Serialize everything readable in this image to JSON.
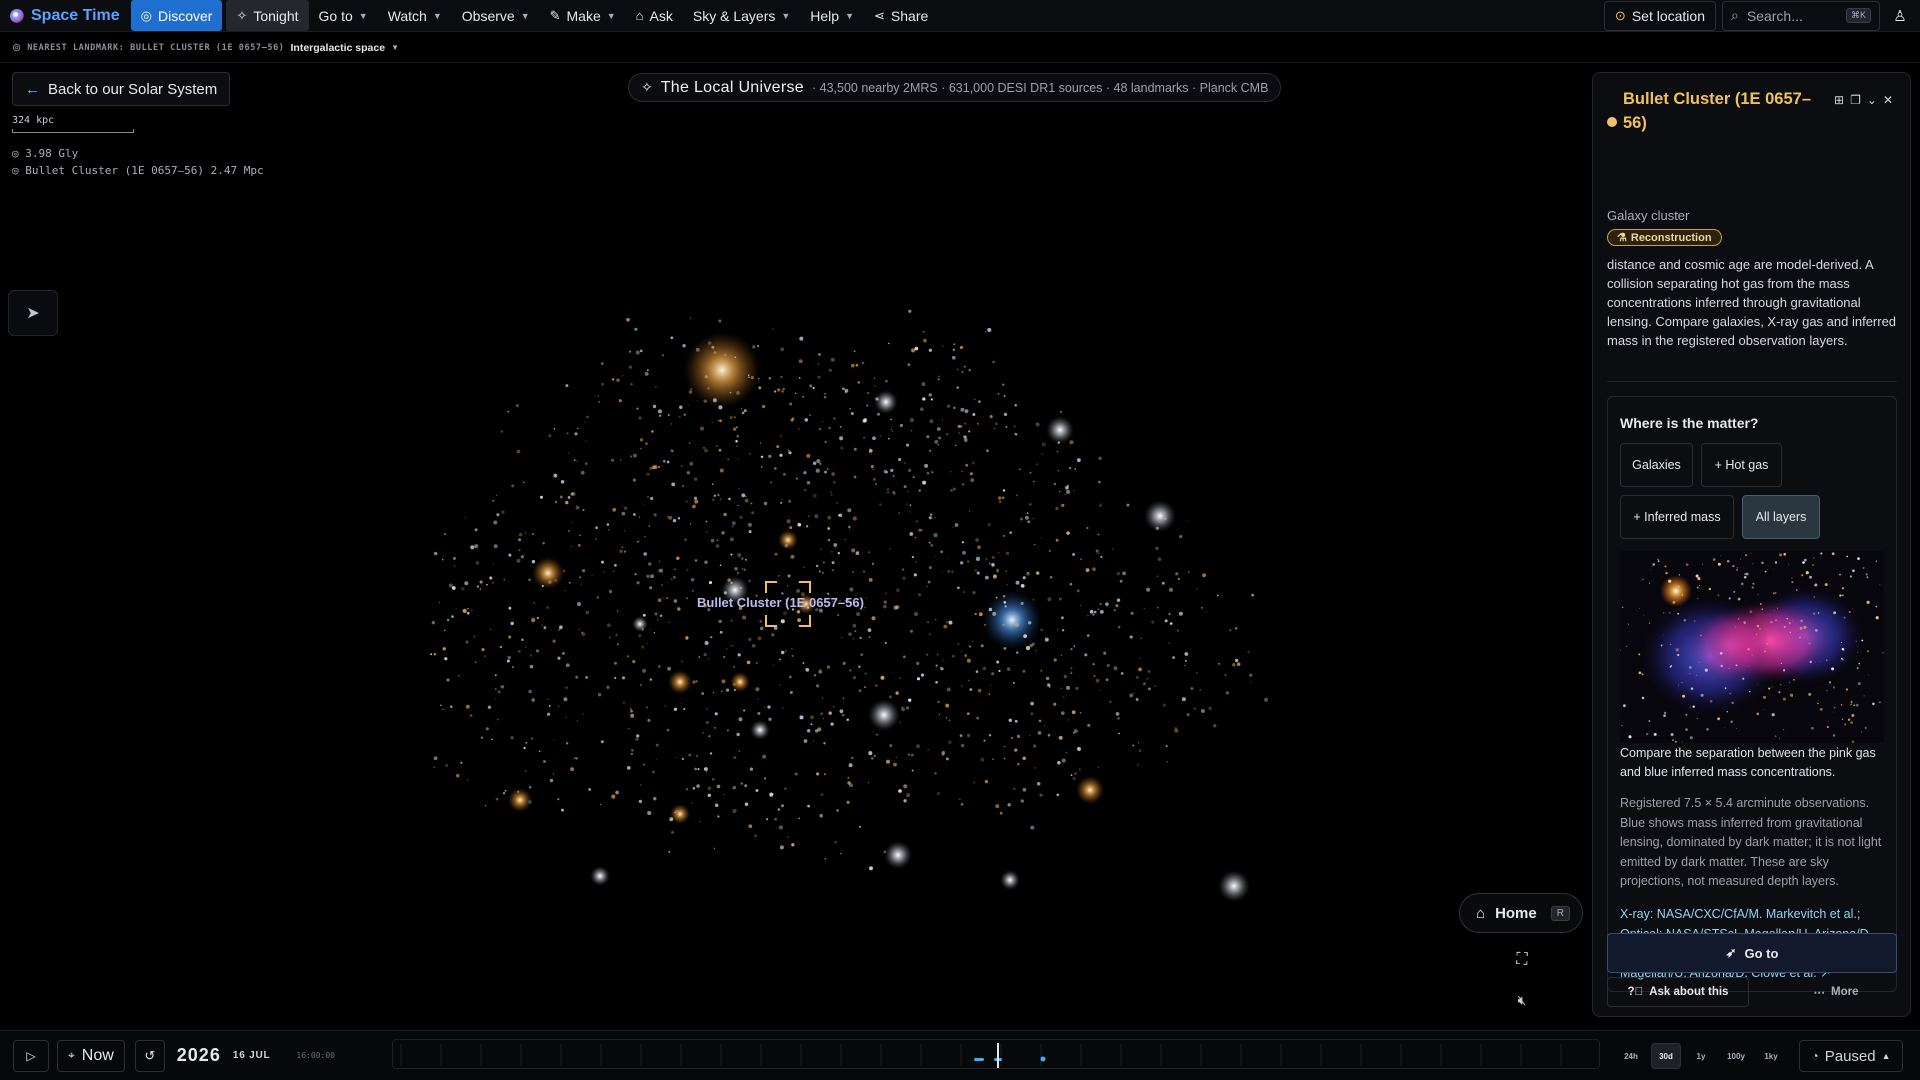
{
  "app": {
    "name": "Space Time"
  },
  "nav": {
    "discover": "Discover",
    "tonight": "Tonight",
    "goto": "Go to",
    "watch": "Watch",
    "observe": "Observe",
    "make": "Make",
    "ask": "Ask",
    "sky_layers": "Sky & Layers",
    "help": "Help",
    "share": "Share",
    "set_location": "Set location",
    "search_placeholder": "Search...",
    "search_shortcut": "⌘K"
  },
  "landmark": {
    "label": "NEAREST LANDMARK: BULLET CLUSTER (1E 0657–56)",
    "region": "Intergalactic space"
  },
  "view": {
    "back_label": "Back to our Solar System",
    "scale": "324 kpc",
    "distances": [
      "◎ 3.98 Gly",
      "◎ Bullet Cluster (1E 0657–56) 2.47 Mpc"
    ],
    "universe_title": "The Local Universe",
    "universe_stats": "· 43,500 nearby 2MRS · 631,000 DESI DR1 sources · 48 landmarks · Planck CMB",
    "target_label": "Bullet Cluster (1E 0657–56)",
    "home_label": "Home",
    "home_key": "R"
  },
  "panel": {
    "title": "Bullet Cluster (1E 0657–56)",
    "subtitle": "Galaxy cluster",
    "badge": "Reconstruction",
    "description": "distance and cosmic age are model-derived. A collision separating hot gas from the mass concentrations inferred through gravitational lensing. Compare galaxies, X-ray gas and inferred mass in the registered observation layers.",
    "matter_title": "Where is the matter?",
    "chips": [
      "Galaxies",
      "+ Hot gas",
      "+ Inferred mass",
      "All layers"
    ],
    "active_chip": "All layers",
    "caption": "Compare the separation between the pink gas and blue inferred mass concentrations.",
    "note": "Registered 7.5 × 5.4 arcminute observations. Blue shows mass inferred from gravitational lensing, dominated by dark matter; it is not light emitted by dark matter. These are sky projections, not measured depth layers.",
    "credit": "X-ray: NASA/CXC/CfA/M. Markevitch et al.; Optical: NASA/STScI, Magellan/U. Arizona/D. Clowe et al.; Lensing: NASA/STScI, ESO WFI, Magellan/U. Arizona/D. Clowe et al. ↗",
    "goto_label": "Go to",
    "ask_label": "Ask about this",
    "more_label": "More"
  },
  "timeline": {
    "now_label": "Now",
    "year": "2026",
    "date": "16 JUL",
    "time": "16:00:00",
    "ranges": [
      "24h",
      "30d",
      "1y",
      "100y",
      "1ky"
    ],
    "active_range": "30d",
    "status": "Paused"
  },
  "colors": {
    "accent": "#1f6fd1",
    "brand": "#5aa2ff",
    "title_gold": "#f0c060",
    "credit_cyan": "#8fd4f0"
  }
}
